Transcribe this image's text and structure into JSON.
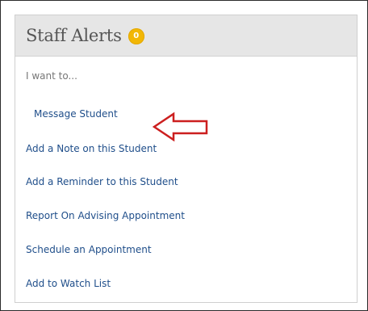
{
  "widget": {
    "title": "Staff Alerts",
    "badge_count": "0",
    "badge_color": "#f2b705"
  },
  "menu": {
    "intro": "I want to...",
    "items": [
      {
        "label": "Message Student"
      },
      {
        "label": "Add a Note on this Student"
      },
      {
        "label": "Add a Reminder to this Student"
      },
      {
        "label": "Report On Advising Appointment"
      },
      {
        "label": "Schedule an Appointment"
      },
      {
        "label": "Add to Watch List"
      }
    ]
  },
  "annotation": {
    "arrow_color": "#cc1f1f",
    "icon": "left-arrow-outline"
  }
}
